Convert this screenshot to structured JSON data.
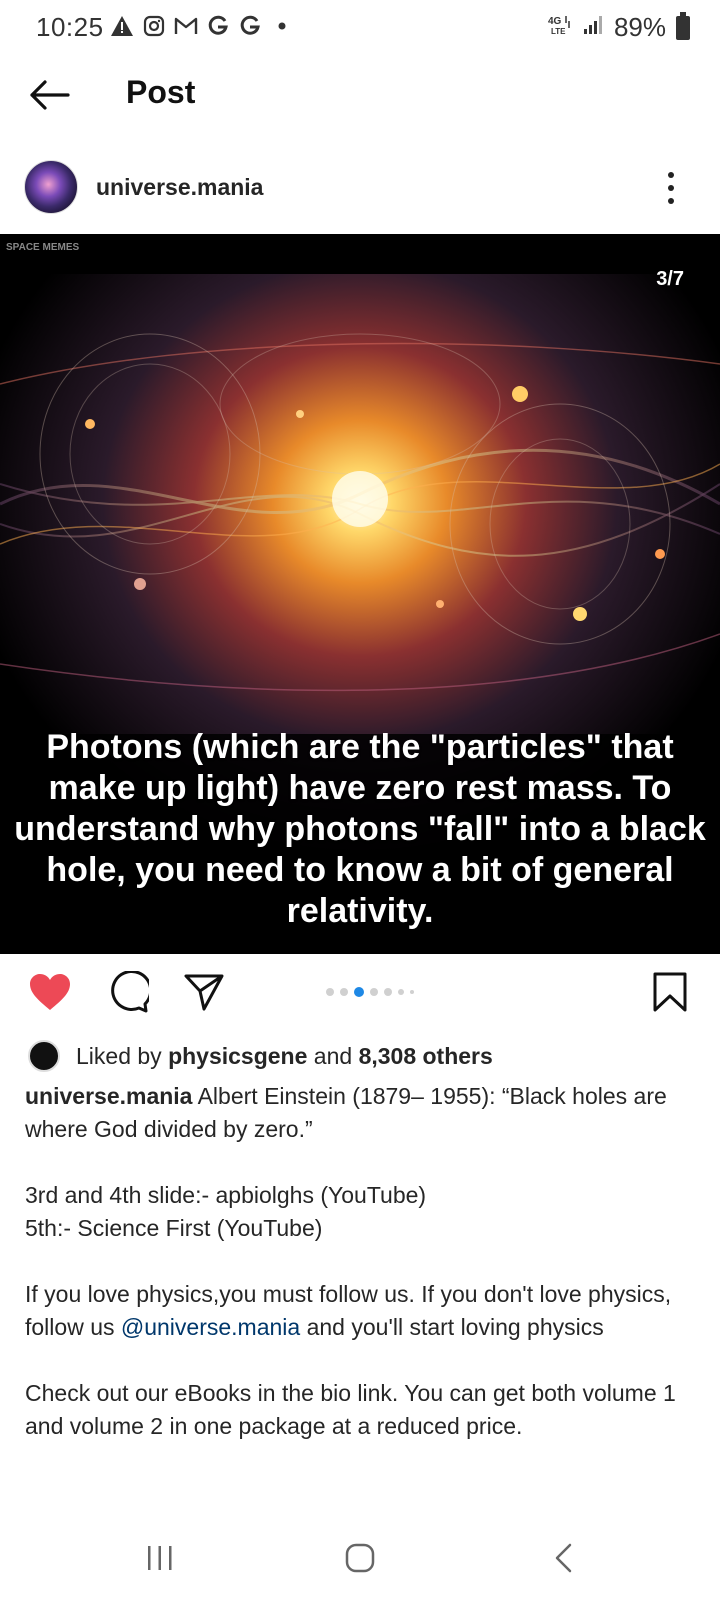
{
  "status_bar": {
    "time": "10:25",
    "battery": "89%",
    "left_icons": [
      "alert-icon",
      "instagram-icon",
      "gmail-icon",
      "google-icon",
      "google-icon",
      "dot-icon"
    ],
    "right_icons": [
      "4g-lte-icon",
      "signal-icon",
      "battery-icon"
    ]
  },
  "header": {
    "title": "Post"
  },
  "post": {
    "username": "universe.mania",
    "watermark": "SPACE MEMES",
    "slide_counter": "3/7",
    "image_caption": "Photons (which are the \"particles\" that make up light) have zero rest mass. To understand why photons \"fall\" into a black hole, you need to know a bit of general relativity.",
    "carousel": {
      "current": 3,
      "total": 7
    }
  },
  "likes": {
    "prefix": "Liked by ",
    "liker": "physicsgene",
    "middle": " and ",
    "others": "8,308 others"
  },
  "caption": {
    "username": "universe.mania",
    "line1": " Albert Einstein (1879– 1955): “Black holes are where God divided by zero.”",
    "line2": "3rd and 4th slide:- apbiolghs (YouTube)",
    "line3": "5th:- Science First (YouTube)",
    "para3_a": "If you love physics,you must follow us. If you don't love physics, follow us ",
    "mention": "@universe.mania",
    "para3_b": " and you'll start loving physics",
    "para4": "Check out our eBooks in the bio link. You can get both volume 1 and volume 2 in one package at a reduced price."
  },
  "colors": {
    "like_red": "#ed4956",
    "active_dot": "#1e88e5",
    "mention": "#00376b"
  }
}
